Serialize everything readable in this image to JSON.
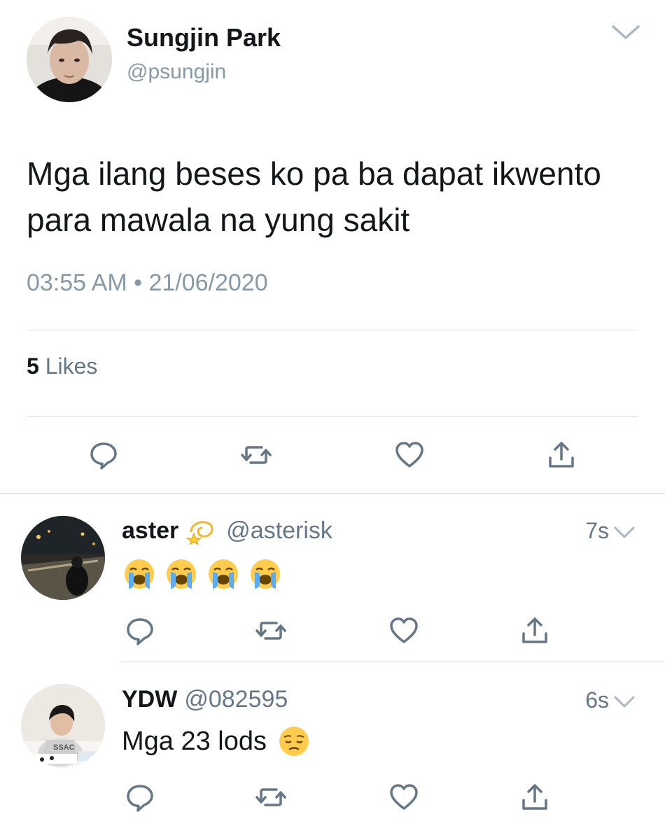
{
  "tweet": {
    "author_name": "Sungjin Park",
    "author_handle": "@psungjin",
    "text": "Mga ilang beses ko pa ba dapat ikwento para mawala na yung sakit",
    "timestamp": "03:55 AM • 21/06/2020",
    "likes_count": "5",
    "likes_label": "Likes"
  },
  "replies": [
    {
      "name": "aster",
      "handle": "@asterisk",
      "time": "7s",
      "name_emoji": "dizzy-emoji",
      "content_emojis": [
        "loudly-crying-face",
        "loudly-crying-face",
        "loudly-crying-face",
        "loudly-crying-face"
      ]
    },
    {
      "name": "YDW",
      "handle": "@082595",
      "time": "6s",
      "text": "Mga 23 lods",
      "trailing_emoji": "pensive-face"
    }
  ],
  "icons": {
    "reply": "reply-icon",
    "retweet": "retweet-icon",
    "like": "heart-icon",
    "share": "share-icon",
    "menu": "chevron-down-icon"
  },
  "colors": {
    "icon_gray": "#657786",
    "secondary_text": "#8899a6",
    "divider": "#d6dde3"
  }
}
